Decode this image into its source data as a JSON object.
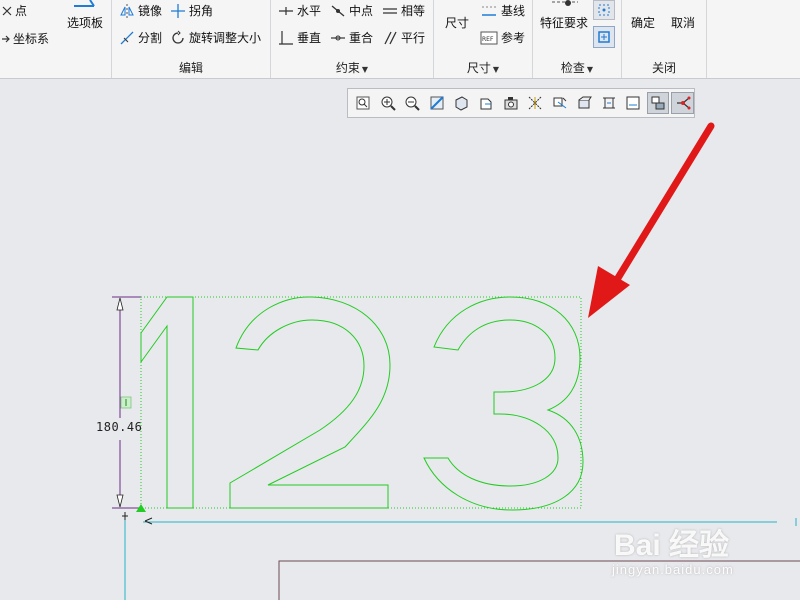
{
  "ribbon": {
    "datum": {
      "point": "点",
      "coord_sys": "坐标系"
    },
    "palette": "选项板",
    "edit": {
      "mirror": "镜像",
      "corner": "拐角",
      "divide": "分割",
      "rotate_resize": "旋转调整大小",
      "label": "编辑"
    },
    "constrain": {
      "horizontal": "水平",
      "midpoint": "中点",
      "equal": "相等",
      "vertical": "垂直",
      "coincident": "重合",
      "parallel": "平行",
      "label": "约束"
    },
    "dimension": {
      "dimension": "尺寸",
      "baseline": "基线",
      "reference": "参考",
      "label": "尺寸"
    },
    "inspect": {
      "feature_req": "特征要求",
      "label": "检查"
    },
    "close": {
      "ok": "确定",
      "cancel": "取消",
      "label": "关闭"
    }
  },
  "graphics_toolbar": {
    "icons": [
      "refit-icon",
      "zoom-in-icon",
      "zoom-out-icon",
      "repaint-icon",
      "display-style-icon",
      "saved-orientations-icon",
      "view-manager-icon",
      "datum-display-icon",
      "annotation-display-icon",
      "spin-center-icon",
      "sketch-orient-icon",
      "sketcher-display-icon",
      "disp-constraints-icon",
      "disp-vertices-icon"
    ]
  },
  "sketch": {
    "text": "123",
    "dimension_value": "180.46",
    "colors": {
      "geometry": "#22cc22",
      "dimension": "#6a2a8a",
      "axis": "#22b3c8",
      "arrow": "#e01818"
    }
  },
  "watermark": {
    "logo": "Bai 经验",
    "url": "jingyan.baidu.com"
  }
}
